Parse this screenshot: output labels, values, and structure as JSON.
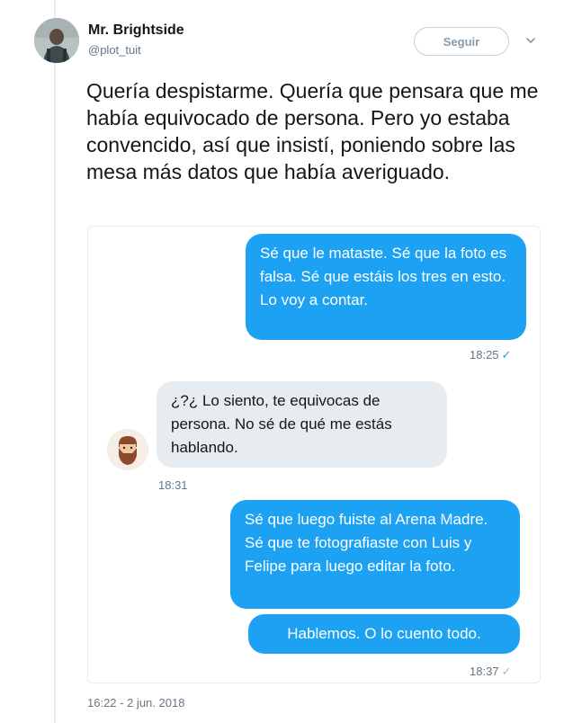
{
  "author": {
    "name": "Mr. Brightside",
    "handle": "@plot_tuit",
    "avatar_icon": "profile-photo-avatar"
  },
  "follow_label": "Seguir",
  "tweet_text": "Quería despistarme. Quería que pensara que me había equivocado de persona. Pero yo estaba convencido, así que insistí, poniendo sobre las mesa más datos que había averiguado.",
  "conversation": {
    "msg1": {
      "text": "Sé que le mataste. Sé que la foto es falsa. Sé que estáis los tres en esto. Lo voy a contar.",
      "time": "18:25",
      "status": "✓"
    },
    "msg2": {
      "text": "¿?¿ Lo siento, te equivocas de persona. No sé de qué me estás hablando.",
      "time": "18:31",
      "sender_icon": "bearded-man-avatar"
    },
    "msg3": {
      "text": "Sé que luego fuiste al Arena Madre. Sé que te fotografiaste con Luis y Felipe para luego editar la foto."
    },
    "msg4": {
      "text": "Hablemos. O lo cuento todo.",
      "time": "18:37",
      "status": "✓"
    }
  },
  "timestamp": "16:22 - 2 jun. 2018",
  "colors": {
    "accent": "#1da1f2",
    "bubble_incoming": "#e6ecf0",
    "muted_text": "#657786"
  }
}
